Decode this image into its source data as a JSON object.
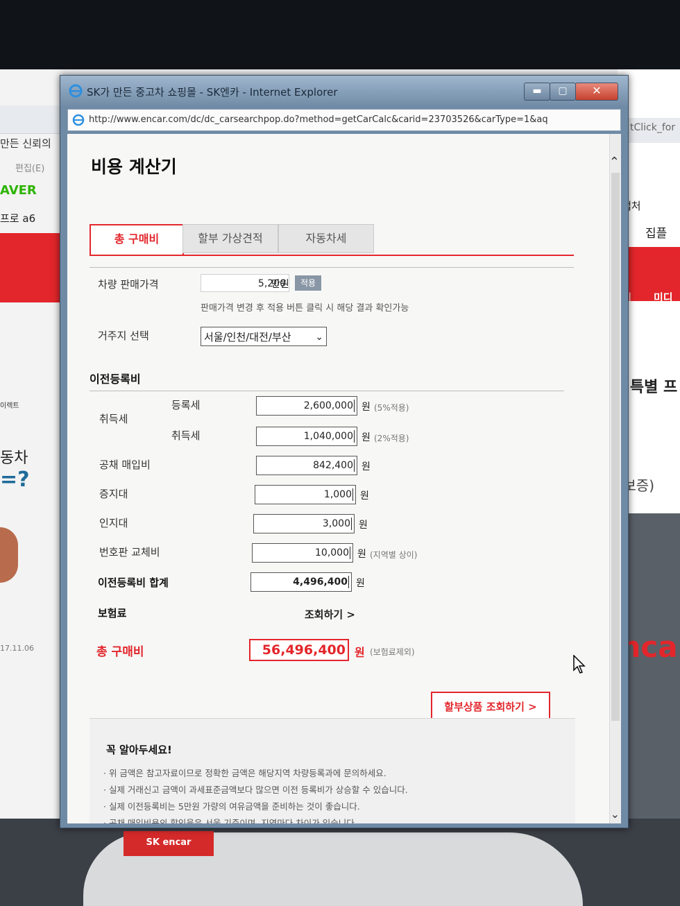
{
  "background": {
    "left_texts": [
      "만든 신뢰의",
      "편집(E)",
      "AVER",
      "프로",
      "a6",
      "이렉트",
      "동차",
      "=?",
      "17.11.06"
    ],
    "right_texts": [
      "tClick_for",
      "캡처",
      "집플",
      "세",
      "미디어",
      "월 특별 프",
      "사보증)",
      "encar"
    ],
    "car_badge": "SK encar"
  },
  "window": {
    "title": "SK가 만든 중고차 쇼핑몰 - SK엔카 - Internet Explorer",
    "url": "http://www.encar.com/dc/dc_carsearchpop.do?method=getCarCalc&carid=23703526&carType=1&aq",
    "min_label": "▬",
    "max_label": "▢",
    "close_label": "✕"
  },
  "calculator": {
    "title": "비용 계산기",
    "tabs": [
      {
        "label": "총 구매비",
        "active": true
      },
      {
        "label": "할부 가상견적",
        "active": false
      },
      {
        "label": "자동차세",
        "active": false
      }
    ],
    "sale_price_label": "차량 판매가격",
    "sale_price_value": "5,200",
    "sale_price_unit": "만원",
    "apply_label": "적용",
    "hint": "판매가격 변경 후 적용 버튼 클릭 시 해당 결과 확인가능",
    "region_label": "거주지 선택",
    "region_value": "서울/인천/대전/부산",
    "transfer_section_title": "이전등록비",
    "acquisition_group_label": "취득세",
    "registration_tax_label": "등록세",
    "registration_tax_value": "2,600,000",
    "registration_tax_note": "(5%적용)",
    "acquisition_tax_label": "취득세",
    "acquisition_tax_value": "1,040,000",
    "acquisition_tax_note": "(2%적용)",
    "bond_label": "공채 매입비",
    "bond_value": "842,400",
    "certificate_label": "증지대",
    "certificate_value": "1,000",
    "stamp_label": "인지대",
    "stamp_value": "3,000",
    "plate_label": "번호판 교체비",
    "plate_value": "10,000",
    "plate_note": "(지역별 상이)",
    "transfer_total_label": "이전등록비 합계",
    "transfer_total_value": "4,496,400",
    "won": "원",
    "insurance_label": "보험료",
    "insurance_link": "조회하기 >",
    "grand_total_label": "총 구매비",
    "grand_total_value": "56,496,400",
    "grand_total_note": "(보험료제외)",
    "installment_button": "할부상품 조회하기 >"
  },
  "notice": {
    "title": "꼭 알아두세요!",
    "lines": [
      "· 위 금액은 참고자료이므로 정확한 금액은 해당지역 차량등록과에 문의하세요.",
      "· 실제 거래신고 금액이 과세표준금액보다 많으면 이전 등록비가 상승할 수 있습니다.",
      "· 실제 이전등록비는 5만원 가량의 여유금액을 준비하는 것이 좋습니다.",
      "· 공채 매입비용의 할인율은 서울 기준이며, 지역마다 차이가 있습니다."
    ]
  },
  "colors": {
    "accent_red": "#e3262b",
    "ie_frame": "#6f8aa5",
    "apply_button": "#8996a5"
  },
  "icons": [
    "ie-logo-icon",
    "globe-icon",
    "chevron-down-icon",
    "scroll-up-icon",
    "scroll-down-icon",
    "mouse-cursor-icon"
  ]
}
